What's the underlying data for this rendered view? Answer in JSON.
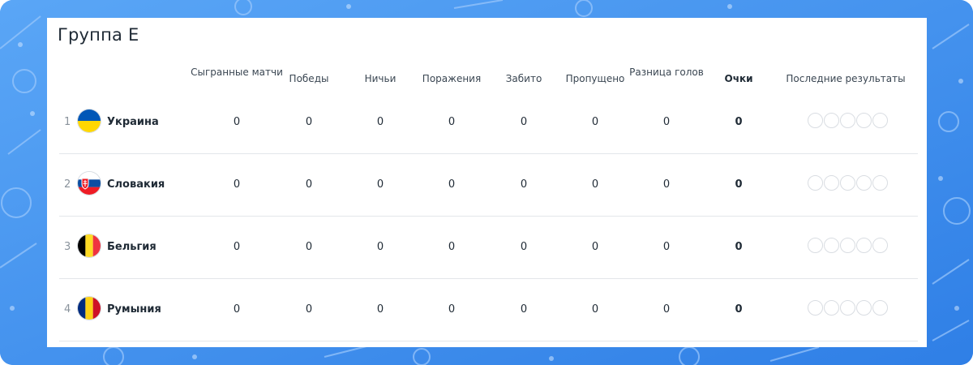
{
  "group": {
    "title": "Группа E"
  },
  "columns": {
    "played": "Сыгранные матчи",
    "wins": "Победы",
    "draws": "Ничьи",
    "losses": "Поражения",
    "scored": "Забито",
    "conceded": "Пропущено",
    "goal_diff": "Разница голов",
    "points": "Очки",
    "last_results": "Последние результаты"
  },
  "teams": [
    {
      "rank": "1",
      "name": "Украина",
      "flag_icon": "flag-ukraine-icon",
      "flag_colors": [
        "#0057b7",
        "#ffd700"
      ],
      "played": "0",
      "wins": "0",
      "draws": "0",
      "losses": "0",
      "scored": "0",
      "conceded": "0",
      "goal_diff": "0",
      "points": "0",
      "last_results": [
        "",
        "",
        "",
        "",
        ""
      ]
    },
    {
      "rank": "2",
      "name": "Словакия",
      "flag_icon": "flag-slovakia-icon",
      "flag_colors": [
        "#ffffff",
        "#0b4ea2",
        "#ee1c25"
      ],
      "played": "0",
      "wins": "0",
      "draws": "0",
      "losses": "0",
      "scored": "0",
      "conceded": "0",
      "goal_diff": "0",
      "points": "0",
      "last_results": [
        "",
        "",
        "",
        "",
        ""
      ]
    },
    {
      "rank": "3",
      "name": "Бельгия",
      "flag_icon": "flag-belgium-icon",
      "flag_colors": [
        "#000000",
        "#fdda24",
        "#ef3340"
      ],
      "played": "0",
      "wins": "0",
      "draws": "0",
      "losses": "0",
      "scored": "0",
      "conceded": "0",
      "goal_diff": "0",
      "points": "0",
      "last_results": [
        "",
        "",
        "",
        "",
        ""
      ]
    },
    {
      "rank": "4",
      "name": "Румыния",
      "flag_icon": "flag-romania-icon",
      "flag_colors": [
        "#002b7f",
        "#fcd116",
        "#ce1126"
      ],
      "played": "0",
      "wins": "0",
      "draws": "0",
      "losses": "0",
      "scored": "0",
      "conceded": "0",
      "goal_diff": "0",
      "points": "0",
      "last_results": [
        "",
        "",
        "",
        "",
        ""
      ]
    }
  ],
  "theme": {
    "background": "#3f8ff0",
    "card": "#ffffff",
    "text": "#1f2a35",
    "muted": "#8a939c",
    "divider": "#e3e6ea"
  }
}
